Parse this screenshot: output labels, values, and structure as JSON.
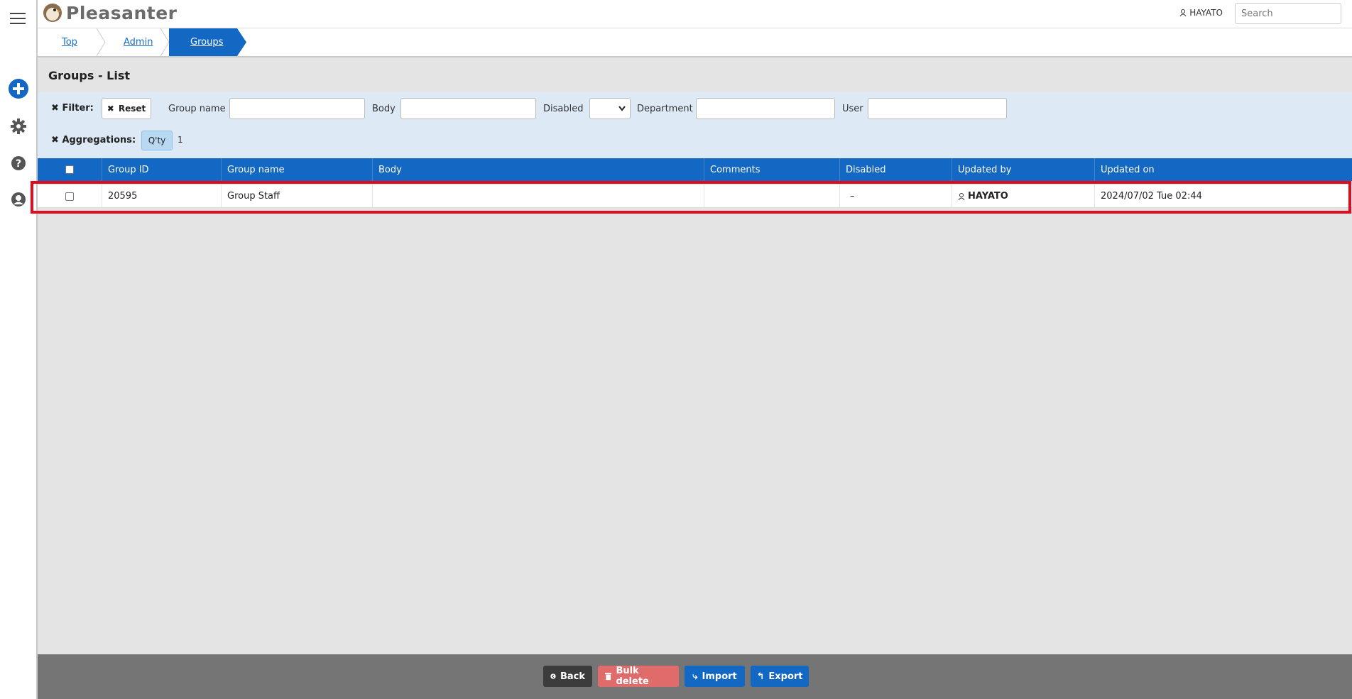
{
  "header": {
    "logo_text": "Pleasanter",
    "user_name": "HAYATO",
    "search_placeholder": "Search"
  },
  "breadcrumb": [
    {
      "label": "Top"
    },
    {
      "label": "Admin"
    },
    {
      "label": "Groups"
    }
  ],
  "page_title": "Groups - List",
  "filter": {
    "label": "Filter:",
    "reset_label": "Reset",
    "fields": [
      {
        "label": "Group name"
      },
      {
        "label": "Body"
      },
      {
        "label": "Disabled"
      },
      {
        "label": "Department"
      },
      {
        "label": "User"
      }
    ]
  },
  "aggregations": {
    "label": "Aggregations:",
    "chip_label": "Q'ty",
    "count": "1"
  },
  "table": {
    "columns": [
      "Group ID",
      "Group name",
      "Body",
      "Comments",
      "Disabled",
      "Updated by",
      "Updated on"
    ],
    "rows": [
      {
        "group_id": "20595",
        "group_name": "Group Staff",
        "body": "",
        "comments": "",
        "disabled": "–",
        "updated_by": "HAYATO",
        "updated_on": "2024/07/02 Tue 02:44"
      }
    ]
  },
  "footer": {
    "back_label": "Back",
    "bulk_delete_label": "Bulk delete",
    "import_label": "Import",
    "export_label": "Export"
  },
  "colors": {
    "accent": "#1268c2",
    "highlight": "#e00b1f",
    "danger": "#e06b6b"
  }
}
